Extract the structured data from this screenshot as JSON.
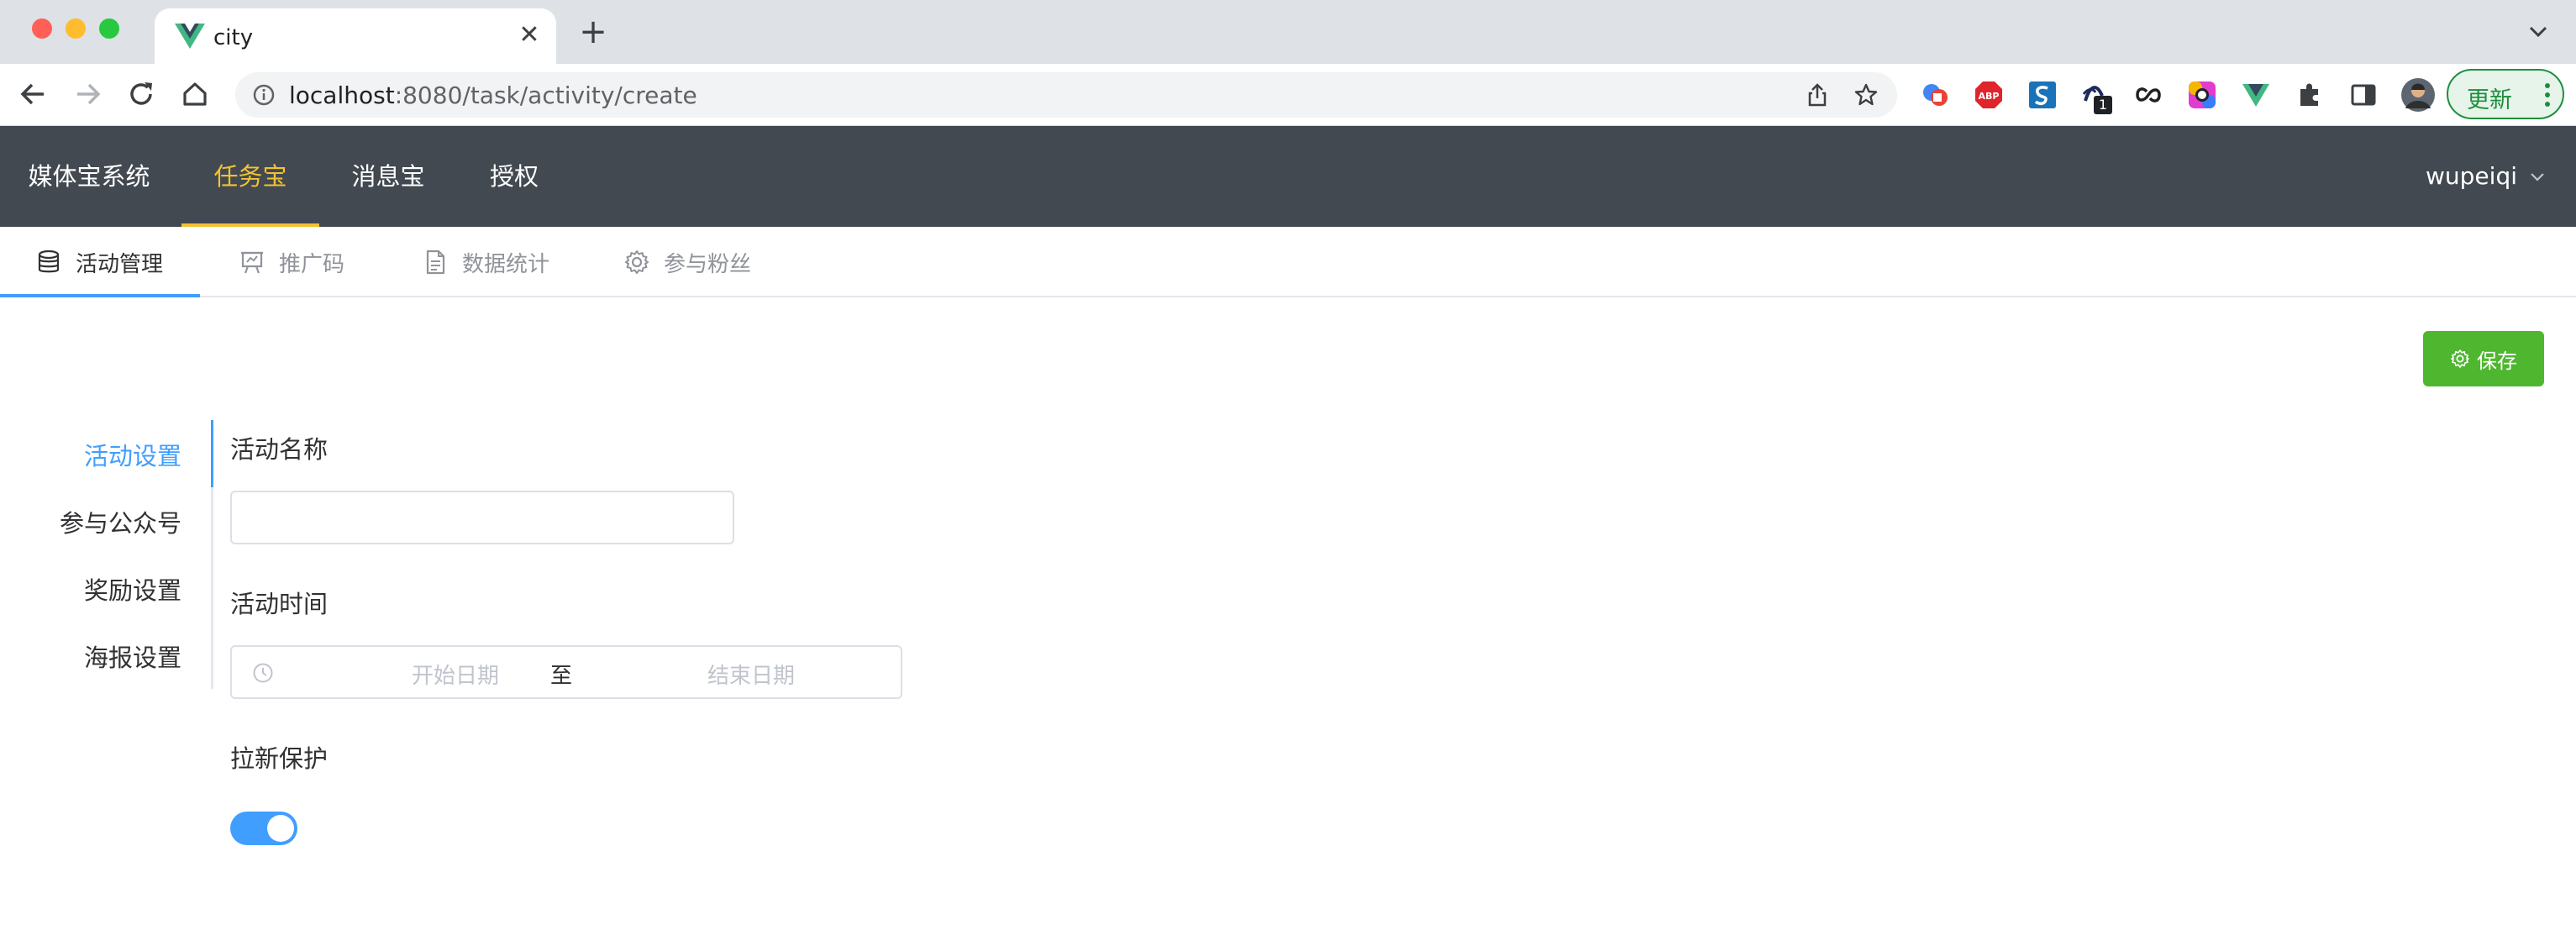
{
  "browser": {
    "tab_title": "city",
    "tab_close": "✕",
    "new_tab": "+",
    "url_host": "localhost",
    "url_path": ":8080/task/activity/create",
    "update_label": "更新",
    "ext_badge": "1",
    "ext_abp": "ABP"
  },
  "header": {
    "nav": [
      "媒体宝系统",
      "任务宝",
      "消息宝",
      "授权"
    ],
    "active_index": 1,
    "user": "wupeiqi"
  },
  "subtabs": {
    "items": [
      "活动管理",
      "推广码",
      "数据统计",
      "参与粉丝"
    ],
    "active_index": 0
  },
  "toolbar": {
    "save_label": "保存"
  },
  "steps": {
    "items": [
      "活动设置",
      "参与公众号",
      "奖励设置",
      "海报设置"
    ],
    "active_index": 0
  },
  "form": {
    "activity_name_label": "活动名称",
    "activity_name_value": "",
    "activity_time_label": "活动时间",
    "start_placeholder": "开始日期",
    "range_separator": "至",
    "end_placeholder": "结束日期",
    "protect_label": "拉新保护",
    "protect_enabled": true
  },
  "colors": {
    "header_bg": "#424951",
    "header_active": "#f1c232",
    "primary": "#409eff",
    "success": "#4fb62f"
  }
}
